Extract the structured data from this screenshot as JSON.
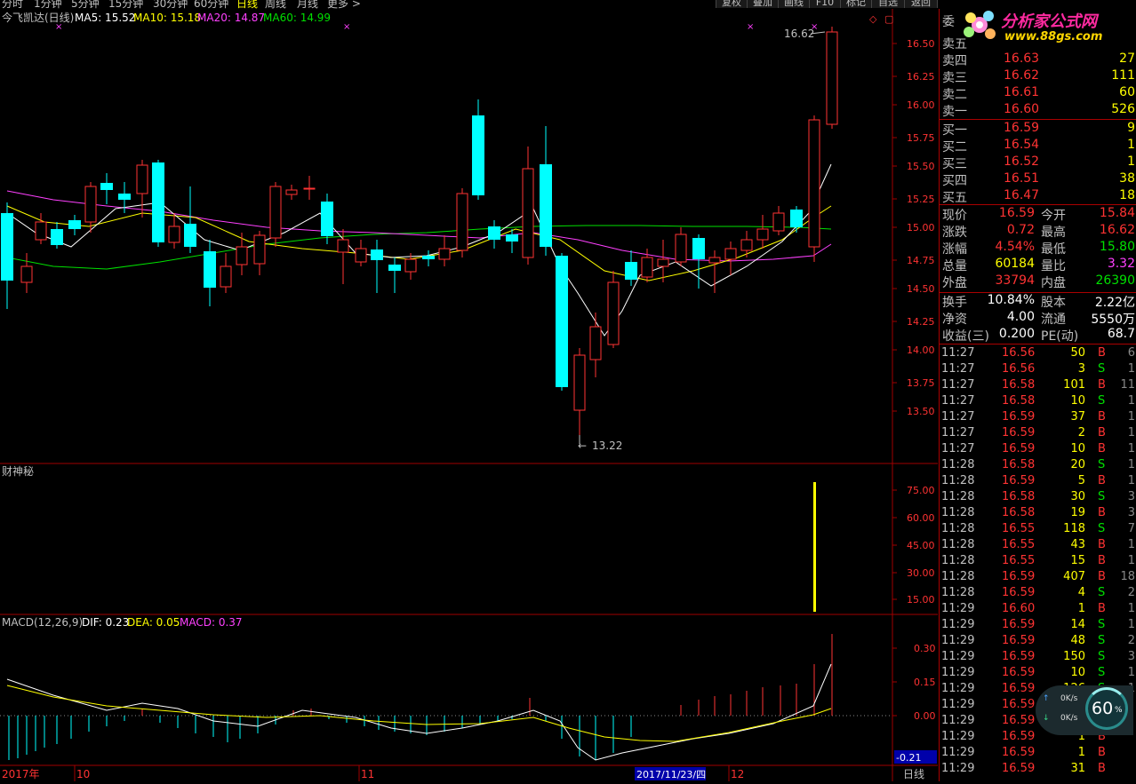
{
  "topbar": {
    "items": [
      "分时",
      "1分钟",
      "5分钟",
      "15分钟",
      "30分钟",
      "60分钟",
      "日线",
      "周线",
      "月线",
      "更多 >"
    ],
    "active_index": 6,
    "buttons": [
      "复权",
      "叠加",
      "画线",
      "F10",
      "标记",
      "自选",
      "返回"
    ]
  },
  "main_chart": {
    "title": "今飞凯达(日线)",
    "ma5_label": "MA5: 15.52",
    "ma10_label": "MA10: 15.18",
    "ma20_label": "MA20: 14.87",
    "ma60_label": "MA60: 14.99",
    "high_label": "16.62",
    "low_label": "13.22",
    "y_ticks": [
      "16.50",
      "16.25",
      "16.00",
      "15.75",
      "15.50",
      "15.25",
      "15.00",
      "14.75",
      "14.50",
      "14.25",
      "14.00",
      "13.75",
      "13.50"
    ]
  },
  "indicator_panel": {
    "title": "财神秘",
    "y_ticks": [
      "75.00",
      "60.00",
      "45.00",
      "30.00",
      "15.00"
    ]
  },
  "macd_panel": {
    "title": "MACD(12,26,9)",
    "dif_label": "DIF: 0.23",
    "dea_label": "DEA: 0.05",
    "macd_label": "MACD: 0.37",
    "y_ticks": [
      "0.30",
      "0.15",
      "0.00"
    ],
    "bottom_value": "-0.21"
  },
  "date_axis": {
    "labels": [
      "2017年",
      "10",
      "11",
      "12"
    ],
    "highlight": "2017/11/23/四",
    "period_label": "日线"
  },
  "logo": {
    "text": "分析家公式网",
    "url_text": "www.88gs.com"
  },
  "order_book": {
    "partial_top": "委",
    "sell": [
      {
        "label": "卖五",
        "price": "",
        "vol": ""
      },
      {
        "label": "卖四",
        "price": "16.63",
        "vol": "27"
      },
      {
        "label": "卖三",
        "price": "16.62",
        "vol": "111"
      },
      {
        "label": "卖二",
        "price": "16.61",
        "vol": "60"
      },
      {
        "label": "卖一",
        "price": "16.60",
        "vol": "526"
      }
    ],
    "buy": [
      {
        "label": "买一",
        "price": "16.59",
        "vol": "9"
      },
      {
        "label": "买二",
        "price": "16.54",
        "vol": "1"
      },
      {
        "label": "买三",
        "price": "16.52",
        "vol": "1"
      },
      {
        "label": "买四",
        "price": "16.51",
        "vol": "38"
      },
      {
        "label": "买五",
        "price": "16.47",
        "vol": "18"
      }
    ]
  },
  "quote": {
    "rows": [
      {
        "l1": "现价",
        "v1": "16.59",
        "l2": "今开",
        "v2": "15.84",
        "c1": "#ff3333",
        "c2": "#ff3333"
      },
      {
        "l1": "涨跌",
        "v1": "0.72",
        "l2": "最高",
        "v2": "16.62",
        "c1": "#ff3333",
        "c2": "#ff3333"
      },
      {
        "l1": "涨幅",
        "v1": "4.54%",
        "l2": "最低",
        "v2": "15.80",
        "c1": "#ff3333",
        "c2": "#00e000"
      },
      {
        "l1": "总量",
        "v1": "60184",
        "l2": "量比",
        "v2": "3.32",
        "c1": "#ffff00",
        "c2": "#ff40ff"
      },
      {
        "l1": "外盘",
        "v1": "33794",
        "l2": "内盘",
        "v2": "26390",
        "c1": "#ff3333",
        "c2": "#00e000"
      }
    ],
    "rows2": [
      {
        "l1": "换手",
        "v1": "10.84%",
        "l2": "股本",
        "v2": "2.22亿"
      },
      {
        "l1": "净资",
        "v1": "4.00",
        "l2": "流通",
        "v2": "5550万"
      },
      {
        "l1": "收益(三)",
        "v1": "0.200",
        "l2": "PE(动)",
        "v2": "68.7"
      }
    ]
  },
  "ticks": [
    {
      "t": "11:27",
      "p": "16.56",
      "v": "50",
      "s": "B",
      "n": "6"
    },
    {
      "t": "11:27",
      "p": "16.56",
      "v": "3",
      "s": "S",
      "n": "1"
    },
    {
      "t": "11:27",
      "p": "16.58",
      "v": "101",
      "s": "B",
      "n": "11"
    },
    {
      "t": "11:27",
      "p": "16.58",
      "v": "10",
      "s": "S",
      "n": "1"
    },
    {
      "t": "11:27",
      "p": "16.59",
      "v": "37",
      "s": "B",
      "n": "1"
    },
    {
      "t": "11:27",
      "p": "16.59",
      "v": "2",
      "s": "B",
      "n": "1"
    },
    {
      "t": "11:27",
      "p": "16.59",
      "v": "10",
      "s": "B",
      "n": "1"
    },
    {
      "t": "11:28",
      "p": "16.58",
      "v": "20",
      "s": "S",
      "n": "1"
    },
    {
      "t": "11:28",
      "p": "16.59",
      "v": "5",
      "s": "B",
      "n": "1"
    },
    {
      "t": "11:28",
      "p": "16.58",
      "v": "30",
      "s": "S",
      "n": "3"
    },
    {
      "t": "11:28",
      "p": "16.58",
      "v": "19",
      "s": "B",
      "n": "3"
    },
    {
      "t": "11:28",
      "p": "16.55",
      "v": "118",
      "s": "S",
      "n": "7"
    },
    {
      "t": "11:28",
      "p": "16.55",
      "v": "43",
      "s": "B",
      "n": "1"
    },
    {
      "t": "11:28",
      "p": "16.55",
      "v": "15",
      "s": "B",
      "n": "1"
    },
    {
      "t": "11:28",
      "p": "16.59",
      "v": "407",
      "s": "B",
      "n": "18"
    },
    {
      "t": "11:28",
      "p": "16.59",
      "v": "4",
      "s": "S",
      "n": "2"
    },
    {
      "t": "11:29",
      "p": "16.60",
      "v": "1",
      "s": "B",
      "n": "1"
    },
    {
      "t": "11:29",
      "p": "16.59",
      "v": "14",
      "s": "S",
      "n": "1"
    },
    {
      "t": "11:29",
      "p": "16.59",
      "v": "48",
      "s": "S",
      "n": "2"
    },
    {
      "t": "11:29",
      "p": "16.59",
      "v": "150",
      "s": "S",
      "n": "3"
    },
    {
      "t": "11:29",
      "p": "16.59",
      "v": "10",
      "s": "S",
      "n": "1"
    },
    {
      "t": "11:29",
      "p": "16.59",
      "v": "126",
      "s": "S",
      "n": "1"
    },
    {
      "t": "11:29",
      "p": "16.59",
      "v": "",
      "s": "",
      "n": ""
    },
    {
      "t": "11:29",
      "p": "16.59",
      "v": "",
      "s": "",
      "n": ""
    },
    {
      "t": "11:29",
      "p": "16.59",
      "v": "1",
      "s": "B",
      "n": ""
    },
    {
      "t": "11:29",
      "p": "16.59",
      "v": "1",
      "s": "B",
      "n": ""
    },
    {
      "t": "11:29",
      "p": "16.59",
      "v": "31",
      "s": "B",
      "n": ""
    }
  ],
  "net_widget": {
    "up": "0K/s",
    "down": "0K/s",
    "percent": "60",
    "unit": "%"
  },
  "colors": {
    "up": "#ff3333",
    "down": "#00ffff",
    "ma5": "#ffffff",
    "ma10": "#ffff00",
    "ma20": "#ff40ff",
    "ma60": "#00e000",
    "grid": "#a00000"
  }
}
